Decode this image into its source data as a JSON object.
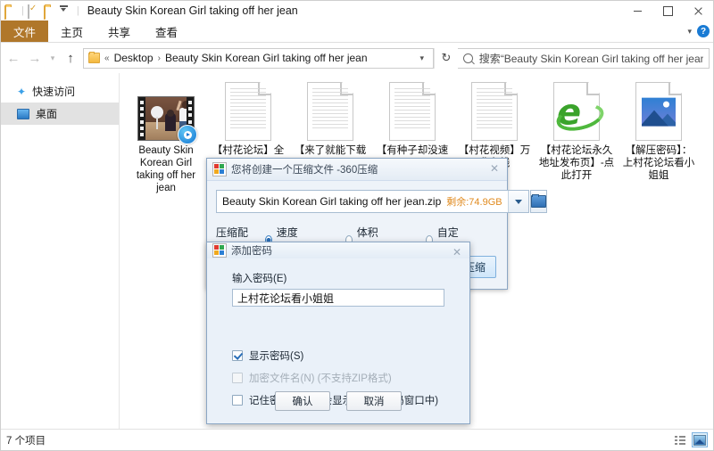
{
  "window": {
    "title": "Beauty Skin Korean Girl taking off her jean",
    "quick_access_icons": [
      "folder-icon",
      "properties-icon",
      "new-folder-icon",
      "customize-caret-icon"
    ],
    "controls": {
      "minimize": "—",
      "maximize": "□",
      "close": "✕"
    }
  },
  "ribbon": {
    "tabs": [
      {
        "label": "文件",
        "active": true
      },
      {
        "label": "主页",
        "active": false
      },
      {
        "label": "共享",
        "active": false
      },
      {
        "label": "查看",
        "active": false
      }
    ],
    "collapse_icon": "chevron-down-icon",
    "help_icon": "?"
  },
  "addressbar": {
    "back": "←",
    "forward": "→",
    "history": "ˇ",
    "up": "↑",
    "breadcrumbs": [
      "Desktop",
      "Beauty Skin Korean Girl taking off her jean"
    ],
    "root_marker": "«",
    "separator": "›",
    "dropdown_icon": "chevron-down-icon",
    "refresh_icon": "↻"
  },
  "search": {
    "icon": "search-icon",
    "text": "搜索“Beauty Skin Korean Girl taking off her jean”"
  },
  "sidebar": {
    "items": [
      {
        "label": "快速访问",
        "icon": "star-icon",
        "selected": false
      },
      {
        "label": "桌面",
        "icon": "desktop-icon",
        "selected": true
      }
    ]
  },
  "files": [
    {
      "name": "Beauty Skin Korean Girl taking off her jean",
      "icon": "video-thumbnail"
    },
    {
      "name": "【村花论坛】全",
      "icon": "text-document"
    },
    {
      "name": "【来了就能下载",
      "icon": "text-document"
    },
    {
      "name": "【有种子却没速",
      "icon": "text-document"
    },
    {
      "name": "【村花视频】万费在线",
      "icon": "text-document"
    },
    {
      "name": "【村花论坛永久地址发布页】-点此打开",
      "icon": "internet-explorer"
    },
    {
      "name": "【解压密码】：上村花论坛看小姐姐",
      "icon": "picture"
    }
  ],
  "statusbar": {
    "item_count": "7 个项目",
    "view_details_icon": "details-view-icon",
    "view_thumbnails_icon": "thumbnails-view-icon"
  },
  "compress_dialog": {
    "title": "您将创建一个压缩文件 -360压缩",
    "close_label": "✕",
    "archive_name": "Beauty Skin Korean Girl taking off her jean.zip",
    "free_space": "剩余:74.9GB",
    "dropdown_icon": "chevron-down-icon",
    "browse_icon": "folder-icon",
    "config_label": "压缩配置：",
    "options": [
      {
        "label": "速度最快",
        "selected": true
      },
      {
        "label": "体积最小",
        "selected": false
      },
      {
        "label": "自定义",
        "selected": false
      }
    ],
    "compress_button": "压缩"
  },
  "password_dialog": {
    "title": "添加密码",
    "close_label": "✕",
    "input_label": "输入密码(E)",
    "input_accel": "E",
    "input_value": "上村花论坛看小姐姐",
    "checkboxes": [
      {
        "label": "显示密码(S)",
        "checked": true,
        "disabled": false
      },
      {
        "label": "加密文件名(N) (不支持ZIP格式)",
        "checked": false,
        "disabled": true
      },
      {
        "label": "记住密码(M) (将会显示在管理密码窗口中)",
        "checked": false,
        "disabled": false
      }
    ],
    "ok_button": "确认",
    "cancel_button": "取消"
  },
  "colors": {
    "file_tab": "#b0772a",
    "accent_blue": "#1a7bd4",
    "free_space_orange": "#e08a1e",
    "selection_gray": "#e2e2e2"
  }
}
